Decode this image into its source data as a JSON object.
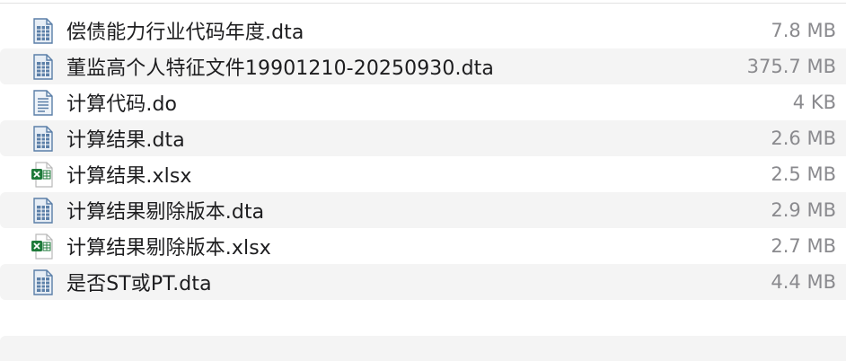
{
  "files": [
    {
      "name": "偿债能力行业代码年度.dta",
      "size": "7.8 MB",
      "icon": "document-icon"
    },
    {
      "name": "董监高个人特征文件19901210-20250930.dta",
      "size": "375.7 MB",
      "icon": "document-icon"
    },
    {
      "name": "计算代码.do",
      "size": "4 KB",
      "icon": "text-file-icon"
    },
    {
      "name": "计算结果.dta",
      "size": "2.6 MB",
      "icon": "document-icon"
    },
    {
      "name": "计算结果.xlsx",
      "size": "2.5 MB",
      "icon": "excel-icon"
    },
    {
      "name": "计算结果剔除版本.dta",
      "size": "2.9 MB",
      "icon": "document-icon"
    },
    {
      "name": "计算结果剔除版本.xlsx",
      "size": "2.7 MB",
      "icon": "excel-icon"
    },
    {
      "name": "是否ST或PT.dta",
      "size": "4.4 MB",
      "icon": "document-icon"
    }
  ],
  "colors": {
    "row_alt_bg": "#f4f4f4",
    "icon_blue": "#5b7fa8",
    "excel_green": "#1e7a3a",
    "size_text": "#8a8a8e"
  }
}
